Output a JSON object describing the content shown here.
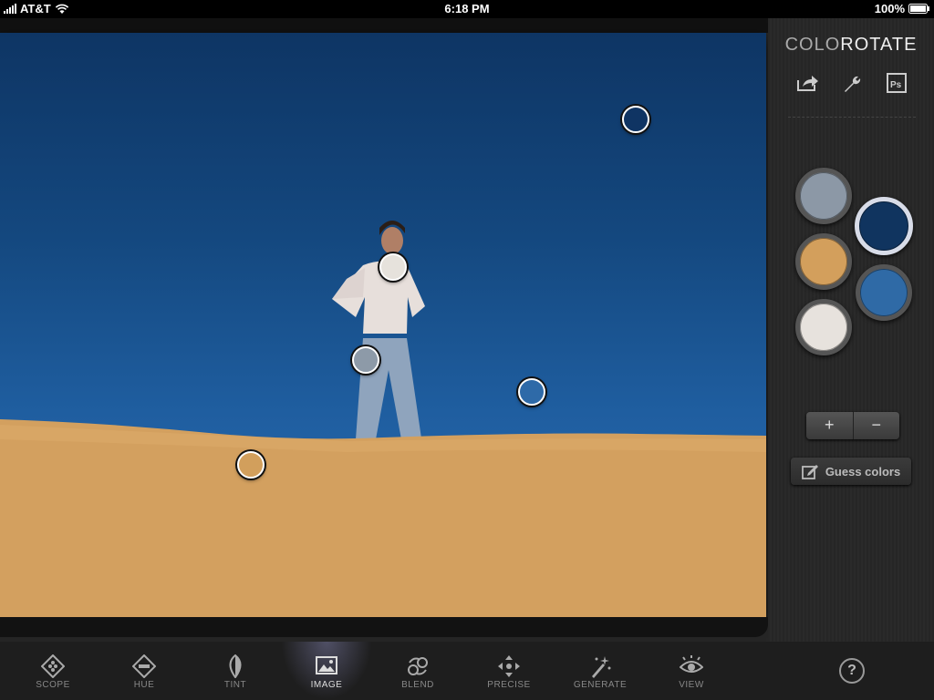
{
  "status_bar": {
    "carrier": "AT&T",
    "time": "6:18 PM",
    "battery": "100%"
  },
  "app": {
    "logo_light": "COLO",
    "logo_bold": "ROTATE"
  },
  "samples": [
    {
      "name": "sky-top",
      "color": "#0f3463"
    },
    {
      "name": "shirt",
      "color": "#e6e2dc"
    },
    {
      "name": "jeans",
      "color": "#8d9aa8"
    },
    {
      "name": "sky-low",
      "color": "#2e6aa8"
    },
    {
      "name": "sand",
      "color": "#d29f5c"
    }
  ],
  "swatches": [
    {
      "name": "gray-blue",
      "color": "#8c98a6"
    },
    {
      "name": "navy",
      "color": "#10345f",
      "selected": true
    },
    {
      "name": "sand",
      "color": "#d39f5c"
    },
    {
      "name": "steel-blue",
      "color": "#2f6aa6"
    },
    {
      "name": "off-white",
      "color": "#e7e2dd"
    }
  ],
  "controls": {
    "plus": "+",
    "minus": "−",
    "guess_label": "Guess colors"
  },
  "toolbar": [
    {
      "label": "SCOPE",
      "icon": "scope-icon"
    },
    {
      "label": "HUE",
      "icon": "hue-icon"
    },
    {
      "label": "TINT",
      "icon": "tint-icon"
    },
    {
      "label": "IMAGE",
      "icon": "image-icon",
      "active": true
    },
    {
      "label": "BLEND",
      "icon": "blend-icon"
    },
    {
      "label": "PRECISE",
      "icon": "precise-icon"
    },
    {
      "label": "GENERATE",
      "icon": "generate-icon"
    },
    {
      "label": "VIEW",
      "icon": "view-icon"
    }
  ],
  "help": "?"
}
